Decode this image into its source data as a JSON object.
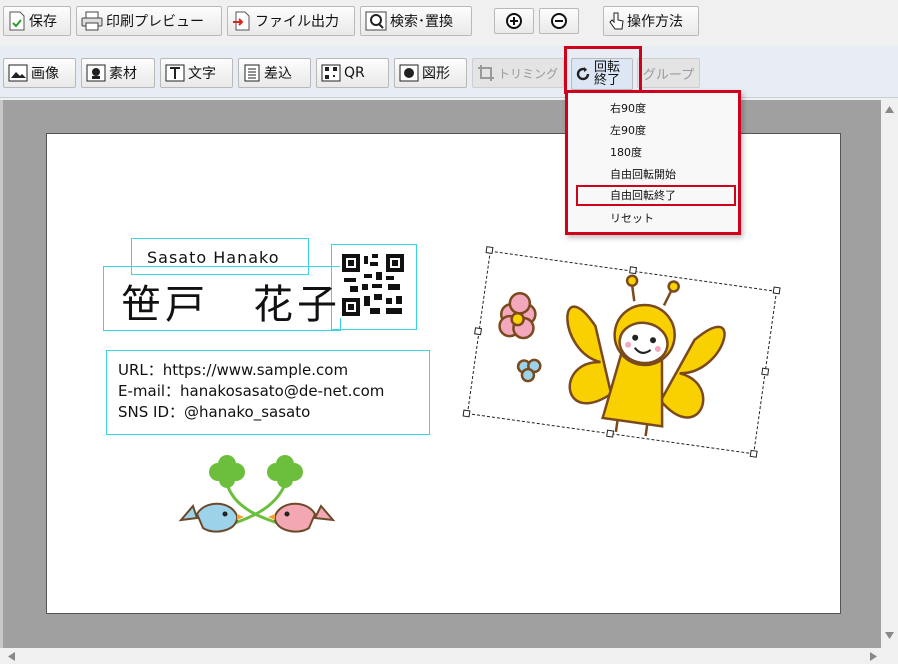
{
  "toolbar1": {
    "save": "保存",
    "print_preview": "印刷プレビュー",
    "file_output": "ファイル出力",
    "search_replace": "検索･置換",
    "how_to": "操作方法"
  },
  "toolbar2": {
    "image": "画像",
    "material": "素材",
    "text": "文字",
    "merge": "差込",
    "qr": "QR",
    "shape": "図形",
    "trimming": "トリミング",
    "rotate_end_line1": "回転",
    "rotate_end_line2": "終了",
    "group": "グループ"
  },
  "dropdown": {
    "items": [
      "右90度",
      "左90度",
      "180度",
      "自由回転開始",
      "自由回転終了",
      "リセット"
    ],
    "selected_index": 4
  },
  "card": {
    "romaji_name": "Sasato Hanako",
    "name": "笹戸　花子",
    "url_line": "URL：https://www.sample.com",
    "email_line": "E-mail：hanakosasato@de-net.com",
    "sns_line": "SNS ID：@hanako_sasato"
  },
  "colors": {
    "highlight": "#d0021b",
    "guide": "#38d6e0",
    "butterfly_yellow": "#f9d000",
    "outline_brown": "#7a4a1e"
  }
}
